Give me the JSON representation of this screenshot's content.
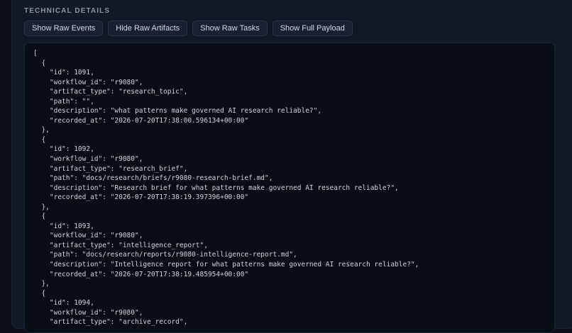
{
  "section": {
    "title": "TECHNICAL DETAILS"
  },
  "buttons": {
    "raw_events": "Show Raw Events",
    "raw_artifacts": "Hide Raw Artifacts",
    "raw_tasks": "Show Raw Tasks",
    "full_payload": "Show Full Payload"
  },
  "payload": {
    "text": "[\n  {\n    \"id\": 1091,\n    \"workflow_id\": \"r9080\",\n    \"artifact_type\": \"research_topic\",\n    \"path\": \"\",\n    \"description\": \"what patterns make governed AI research reliable?\",\n    \"recorded_at\": \"2026-07-20T17:38:00.596134+00:00\"\n  },\n  {\n    \"id\": 1092,\n    \"workflow_id\": \"r9080\",\n    \"artifact_type\": \"research_brief\",\n    \"path\": \"docs/research/briefs/r9080-research-brief.md\",\n    \"description\": \"Research brief for what patterns make governed AI research reliable?\",\n    \"recorded_at\": \"2026-07-20T17:38:19.397396+00:00\"\n  },\n  {\n    \"id\": 1093,\n    \"workflow_id\": \"r9080\",\n    \"artifact_type\": \"intelligence_report\",\n    \"path\": \"docs/research/reports/r9080-intelligence-report.md\",\n    \"description\": \"Intelligence report for what patterns make governed AI research reliable?\",\n    \"recorded_at\": \"2026-07-20T17:38:19.485954+00:00\"\n  },\n  {\n    \"id\": 1094,\n    \"workflow_id\": \"r9080\",\n    \"artifact_type\": \"archive_record\","
  }
}
